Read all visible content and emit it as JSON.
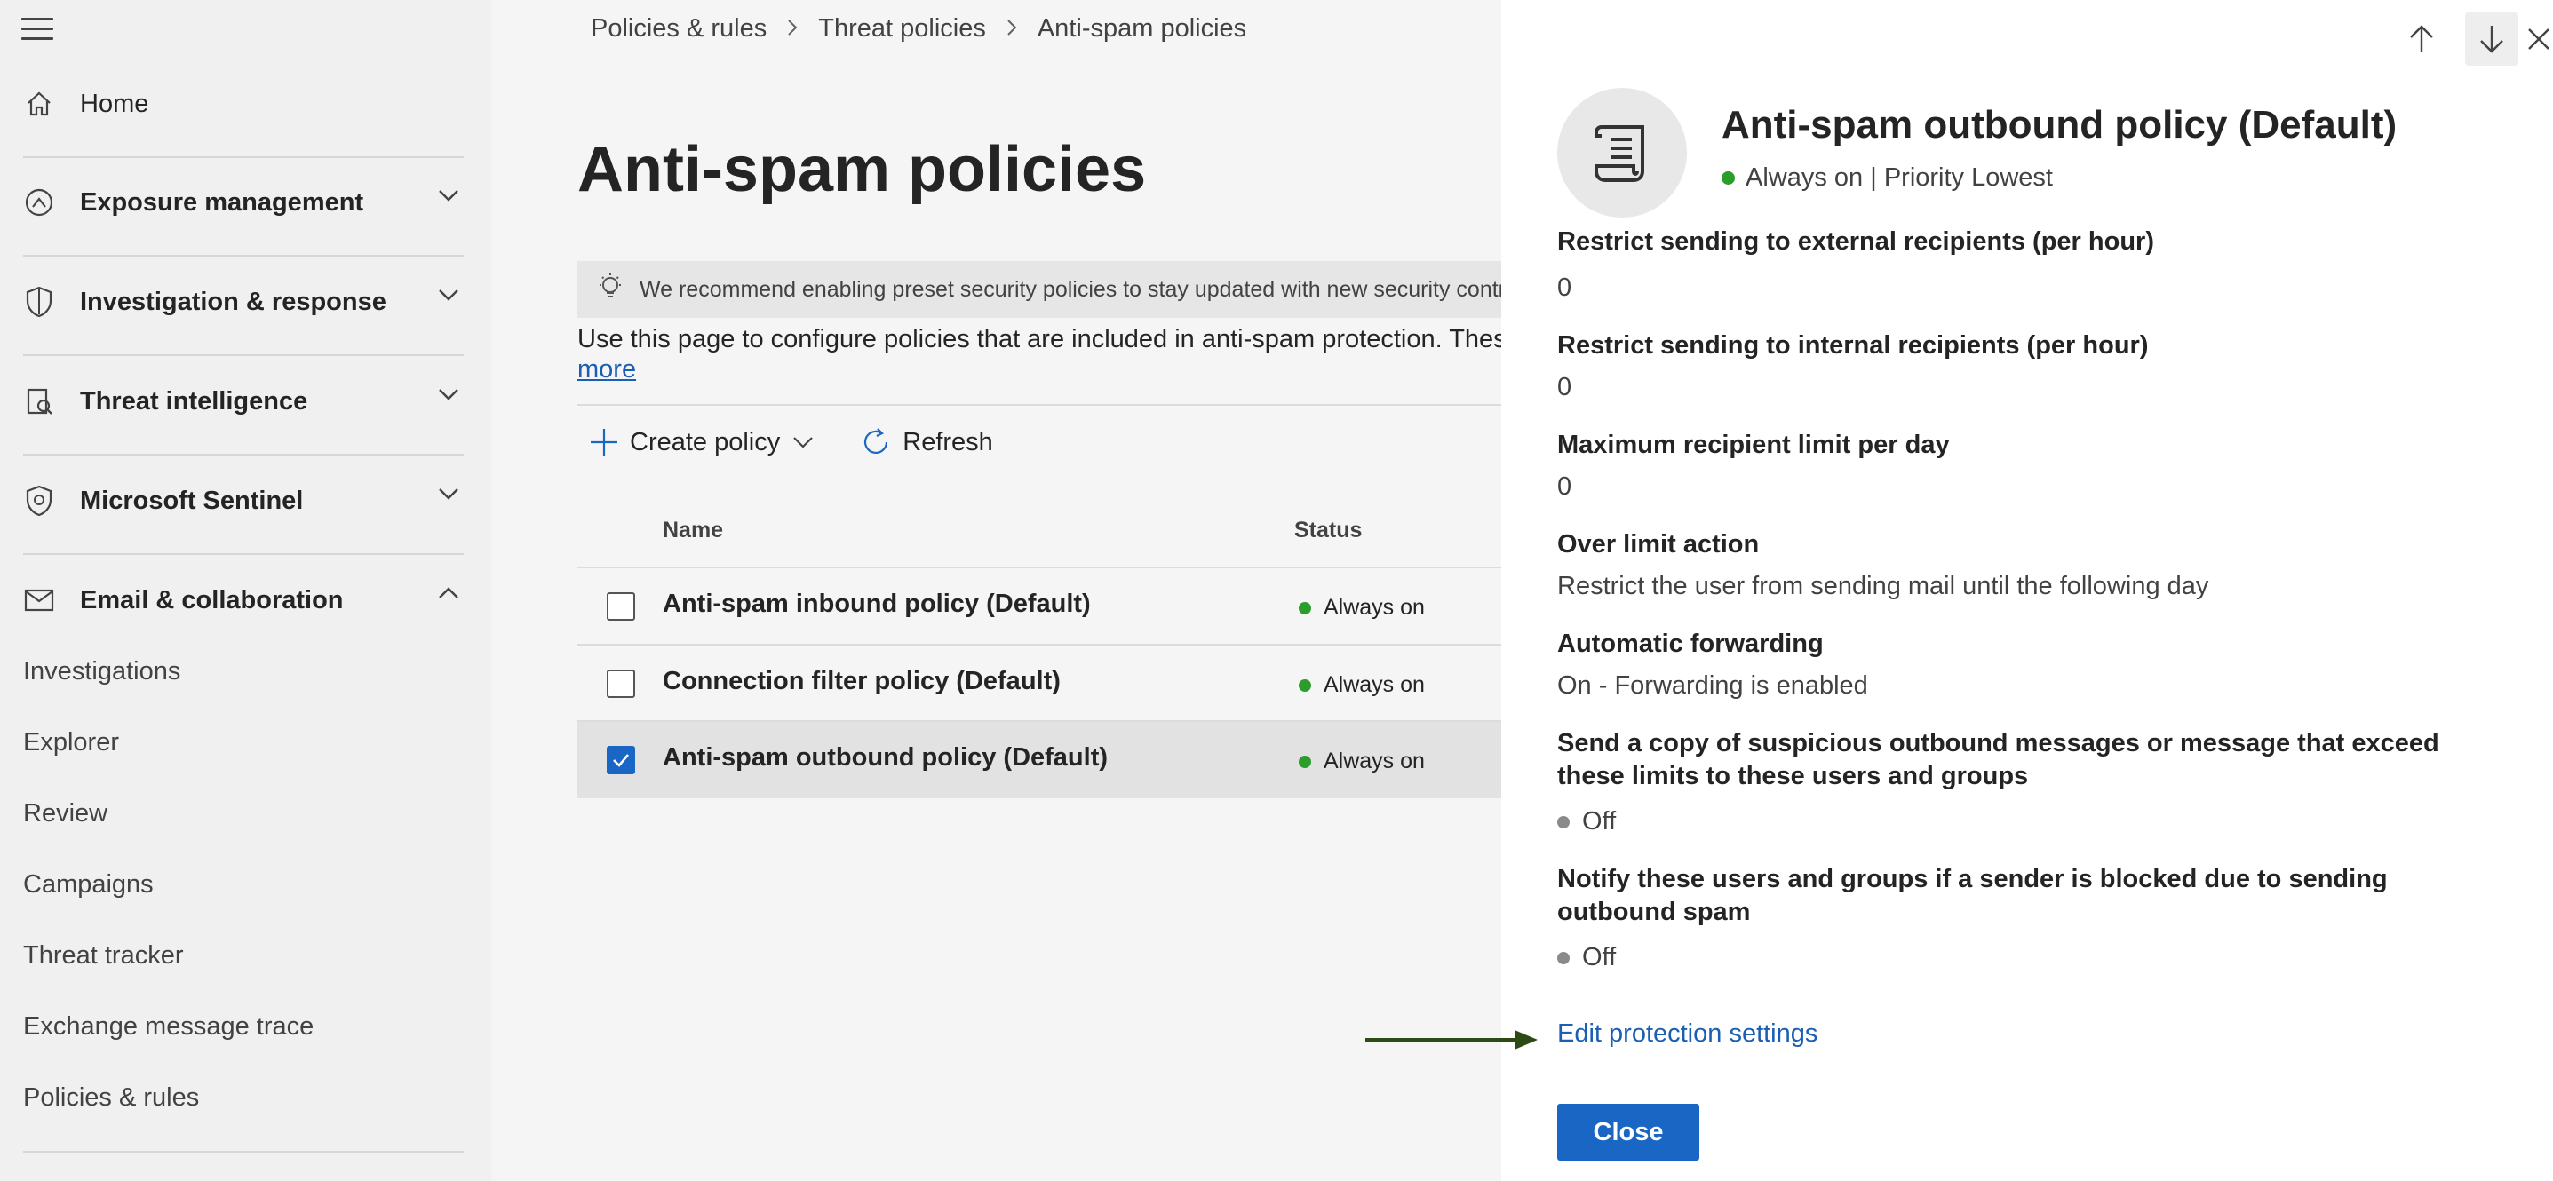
{
  "sidebar": {
    "items": [
      {
        "label": "Home",
        "icon": "home-icon"
      },
      {
        "label": "Exposure management",
        "icon": "exposure-icon"
      },
      {
        "label": "Investigation & response",
        "icon": "shield-icon"
      },
      {
        "label": "Threat intelligence",
        "icon": "threat-intel-icon"
      },
      {
        "label": "Microsoft Sentinel",
        "icon": "sentinel-icon"
      },
      {
        "label": "Email & collaboration",
        "icon": "mail-icon"
      }
    ],
    "sub_items": [
      "Investigations",
      "Explorer",
      "Review",
      "Campaigns",
      "Threat tracker",
      "Exchange message trace",
      "Policies & rules"
    ]
  },
  "breadcrumb": [
    "Policies & rules",
    "Threat policies",
    "Anti-spam policies"
  ],
  "main": {
    "title": "Anti-spam policies",
    "banner": "We recommend enabling preset security policies to stay updated with new security controls",
    "description": "Use this page to configure policies that are included in anti-spam protection. These p",
    "more_link": "more",
    "toolbar": {
      "create": "Create policy",
      "refresh": "Refresh"
    },
    "columns": {
      "name": "Name",
      "status": "Status"
    },
    "rows": [
      {
        "name": "Anti-spam inbound policy (Default)",
        "status": "Always on",
        "checked": false
      },
      {
        "name": "Connection filter policy (Default)",
        "status": "Always on",
        "checked": false
      },
      {
        "name": "Anti-spam outbound policy (Default)",
        "status": "Always on",
        "checked": true
      }
    ]
  },
  "panel": {
    "title": "Anti-spam outbound policy (Default)",
    "subtitle": "Always on | Priority Lowest",
    "fields": [
      {
        "label": "Restrict sending to external recipients (per hour)",
        "value": "0"
      },
      {
        "label": "Restrict sending to internal recipients (per hour)",
        "value": "0"
      },
      {
        "label": "Maximum recipient limit per day",
        "value": "0"
      },
      {
        "label": "Over limit action",
        "value": "Restrict the user from sending mail until the following day"
      },
      {
        "label": "Automatic forwarding",
        "value": "On - Forwarding is enabled"
      },
      {
        "label": "Send a copy of suspicious outbound messages or message that exceed these limits to these users and groups",
        "value": "Off"
      },
      {
        "label": "Notify these users and groups if a sender is blocked due to sending outbound spam",
        "value": "Off"
      }
    ],
    "edit_link": "Edit protection settings",
    "close_label": "Close"
  },
  "colors": {
    "accent": "#1a66c4",
    "link": "#1a5fb4",
    "status_green": "#2a9d2a",
    "arrow": "#2d4a14"
  }
}
